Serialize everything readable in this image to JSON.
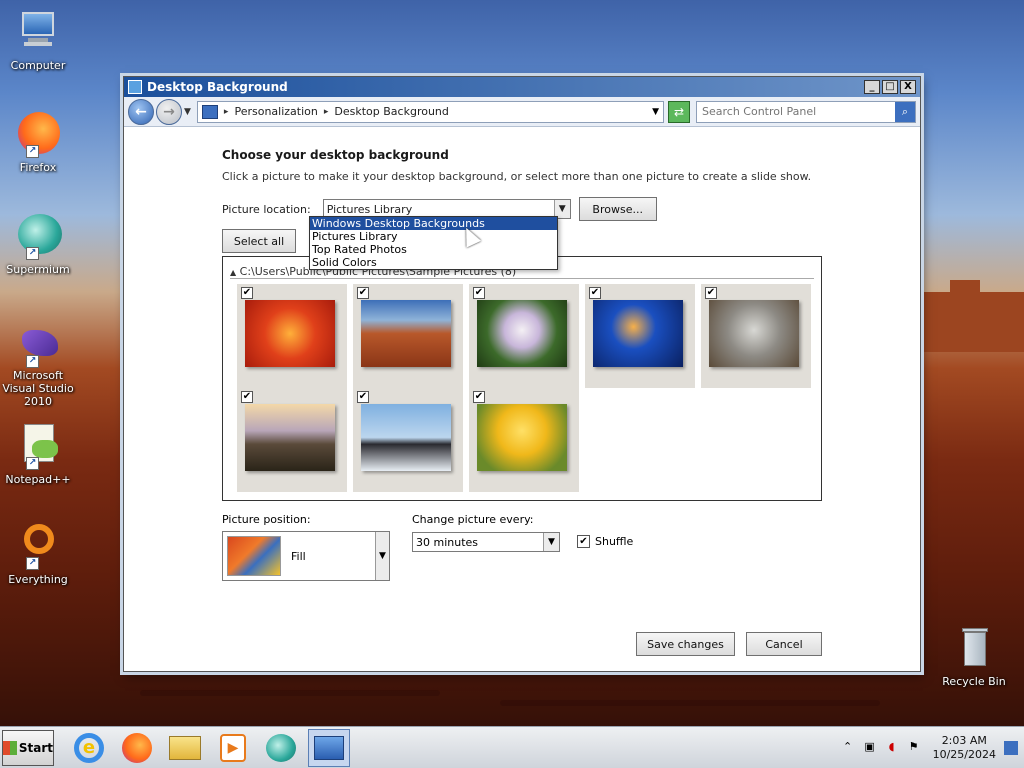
{
  "desktop": {
    "icons": [
      {
        "label": "Computer",
        "icon": "computer-icon"
      },
      {
        "label": "Firefox",
        "icon": "firefox-icon"
      },
      {
        "label": "Supermium",
        "icon": "supermium-icon"
      },
      {
        "label": "Microsoft Visual Studio 2010",
        "icon": "visual-studio-icon"
      },
      {
        "label": "Notepad++",
        "icon": "notepad-plus-plus-icon"
      },
      {
        "label": "Everything",
        "icon": "everything-icon"
      },
      {
        "label": "Recycle Bin",
        "icon": "recycle-bin-icon"
      }
    ]
  },
  "window": {
    "title": "Desktop Background",
    "controls": {
      "minimize": "_",
      "maximize": "□",
      "close": "X"
    },
    "breadcrumb": [
      "Personalization",
      "Desktop Background"
    ],
    "search_placeholder": "Search Control Panel"
  },
  "content": {
    "heading": "Choose your desktop background",
    "subtitle": "Click a picture to make it your desktop background, or select more than one picture to create a slide show.",
    "picture_location_label": "Picture location:",
    "picture_location_value": "Pictures Library",
    "browse_label": "Browse...",
    "select_all_label": "Select all",
    "dropdown_options": [
      "Windows Desktop Backgrounds",
      "Pictures Library",
      "Top Rated Photos",
      "Solid Colors"
    ],
    "dropdown_selected_index": 0,
    "group_header": "C:\\Users\\Public\\Public Pictures\\Sample Pictures (8)",
    "thumbnails": [
      {
        "name": "chrysanthemum",
        "checked": true
      },
      {
        "name": "desert",
        "checked": true
      },
      {
        "name": "hydrangeas",
        "checked": true
      },
      {
        "name": "jellyfish",
        "checked": true
      },
      {
        "name": "koala",
        "checked": true
      },
      {
        "name": "lighthouse",
        "checked": true
      },
      {
        "name": "penguins",
        "checked": true
      },
      {
        "name": "tulips",
        "checked": true
      }
    ],
    "picture_position_label": "Picture position:",
    "picture_position_value": "Fill",
    "change_every_label": "Change picture every:",
    "change_every_value": "30 minutes",
    "shuffle_label": "Shuffle",
    "shuffle_checked": true,
    "save_label": "Save changes",
    "cancel_label": "Cancel"
  },
  "taskbar": {
    "start_label": "Start",
    "apps": [
      "internet-explorer-icon",
      "firefox-icon",
      "file-explorer-icon",
      "media-player-icon",
      "supermium-icon",
      "control-panel-icon"
    ],
    "clock_time": "2:03 AM",
    "clock_date": "10/25/2024"
  }
}
